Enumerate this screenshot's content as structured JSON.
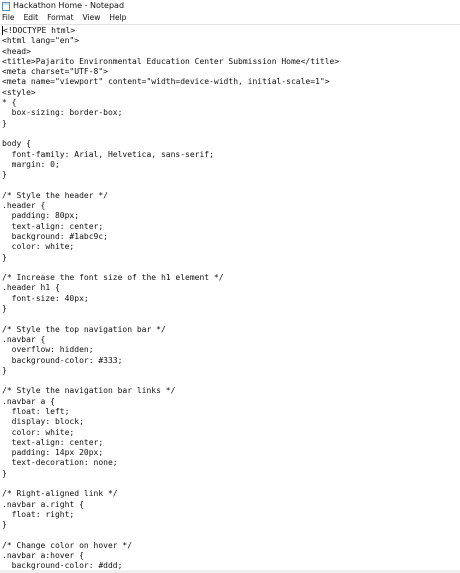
{
  "window": {
    "title": "Hackathon Home - Notepad"
  },
  "menu": {
    "items": [
      "File",
      "Edit",
      "Format",
      "View",
      "Help"
    ]
  },
  "editor": {
    "lines": [
      "<!DOCTYPE html>",
      "<html lang=\"en\">",
      "<head>",
      "<title>Pajarito Environmental Education Center Submission Home</title>",
      "<meta charset=\"UTF-8\">",
      "<meta name=\"viewport\" content=\"width=device-width, initial-scale=1\">",
      "<style>",
      "* {",
      "  box-sizing: border-box;",
      "}",
      "",
      "body {",
      "  font-family: Arial, Helvetica, sans-serif;",
      "  margin: 0;",
      "}",
      "",
      "/* Style the header */",
      ".header {",
      "  padding: 80px;",
      "  text-align: center;",
      "  background: #1abc9c;",
      "  color: white;",
      "}",
      "",
      "/* Increase the font size of the h1 element */",
      ".header h1 {",
      "  font-size: 40px;",
      "}",
      "",
      "/* Style the top navigation bar */",
      ".navbar {",
      "  overflow: hidden;",
      "  background-color: #333;",
      "}",
      "",
      "/* Style the navigation bar links */",
      ".navbar a {",
      "  float: left;",
      "  display: block;",
      "  color: white;",
      "  text-align: center;",
      "  padding: 14px 20px;",
      "  text-decoration: none;",
      "}",
      "",
      "/* Right-aligned link */",
      ".navbar a.right {",
      "  float: right;",
      "}",
      "",
      "/* Change color on hover */",
      ".navbar a:hover {",
      "  background-color: #ddd;"
    ]
  }
}
